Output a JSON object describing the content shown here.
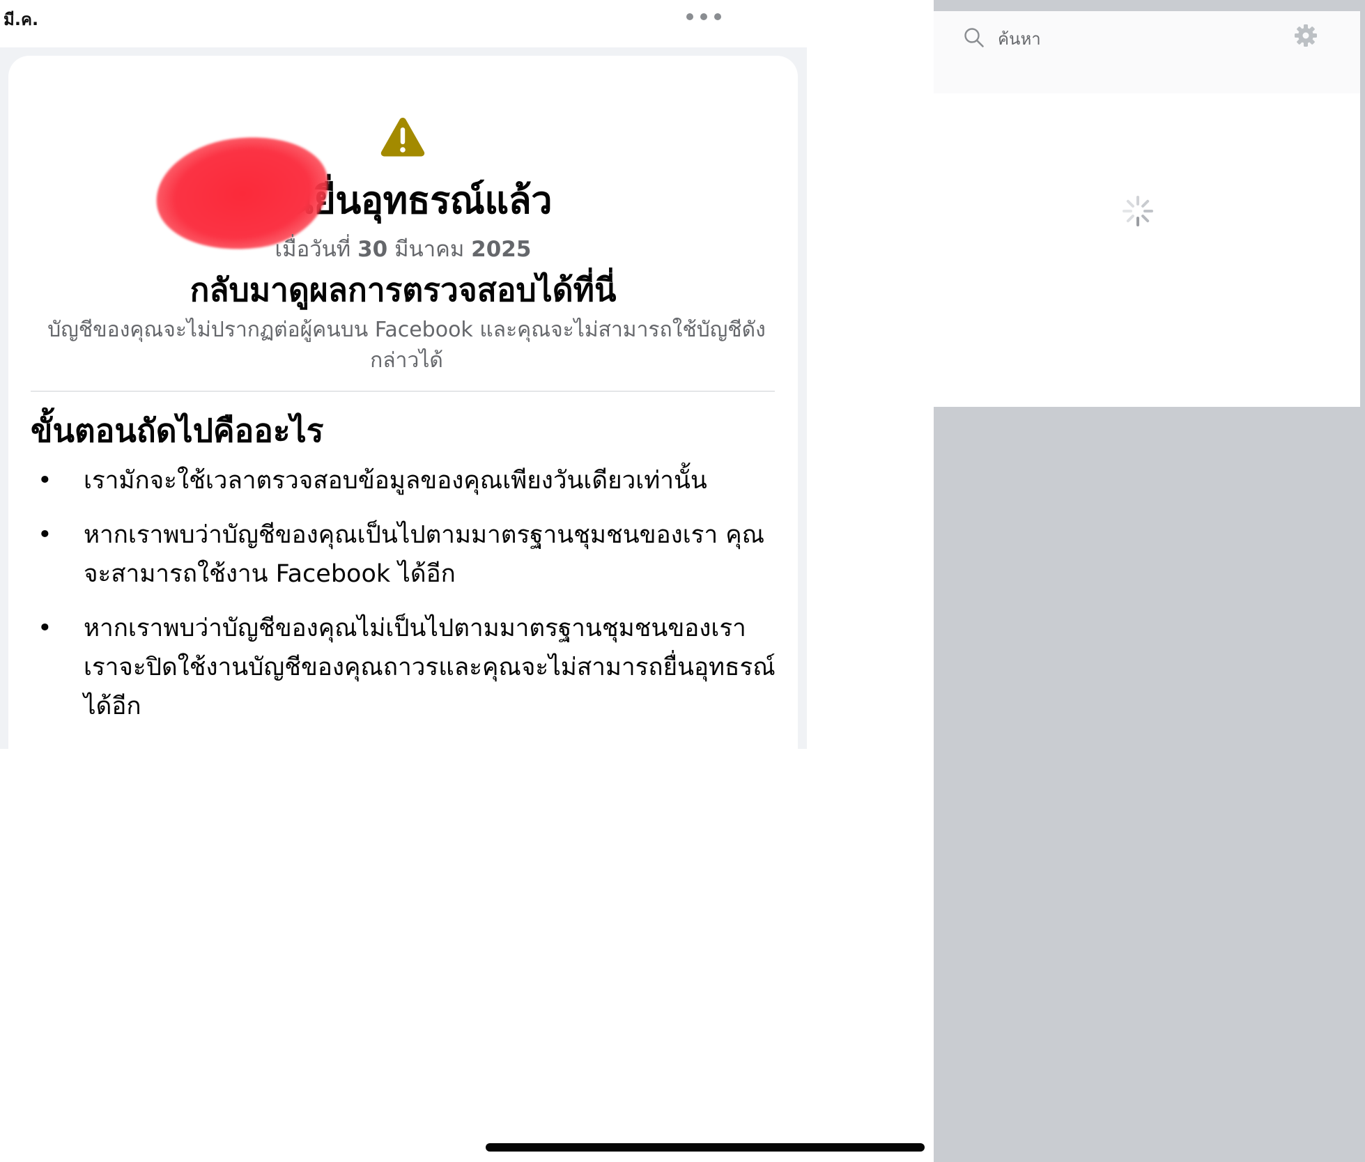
{
  "status_bar": {
    "date": "มี.ค."
  },
  "card": {
    "title": "คุณยื่นอุทธรณ์แล้ว",
    "appeal_date_prefix": "เมื่อวันที่",
    "appeal_day": "30",
    "appeal_month": "มีนาคม",
    "appeal_year": "2025",
    "return_text": "กลับมาดูผลการตรวจสอบได้ที่นี่",
    "hidden_note": "บัญชีของคุณจะไม่ปรากฏต่อผู้คนบน Facebook และคุณจะไม่สามารถใช้บัญชีดังกล่าวได้",
    "next_heading": "ขั้นตอนถัดไปคืออะไร",
    "steps": [
      "เรามักจะใช้เวลาตรวจสอบข้อมูลของคุณเพียงวันเดียวเท่านั้น",
      "หากเราพบว่าบัญชีของคุณเป็นไปตามมาตรฐานชุมชนของเรา คุณจะสามารถใช้งาน Facebook ได้อีก",
      "หากเราพบว่าบัญชีของคุณไม่เป็นไปตามมาตรฐานชุมชนของเรา เราจะปิดใช้งานบัญชีของคุณถาวรและคุณจะไม่สามารถยื่นอุทธรณ์ได้อีก"
    ],
    "bullet": "•",
    "warning_color": "#a38a00"
  },
  "search": {
    "placeholder": "ค้นหา"
  },
  "icons": {
    "more": "more-dots-icon",
    "warning": "warning-triangle-icon",
    "search": "search-icon",
    "settings": "gear-icon",
    "loading": "loading-spinner-icon"
  },
  "colors": {
    "secondary_text": "#65676b",
    "right_panel_bg": "#c9ccd1",
    "redaction": "#fb2a3a"
  }
}
